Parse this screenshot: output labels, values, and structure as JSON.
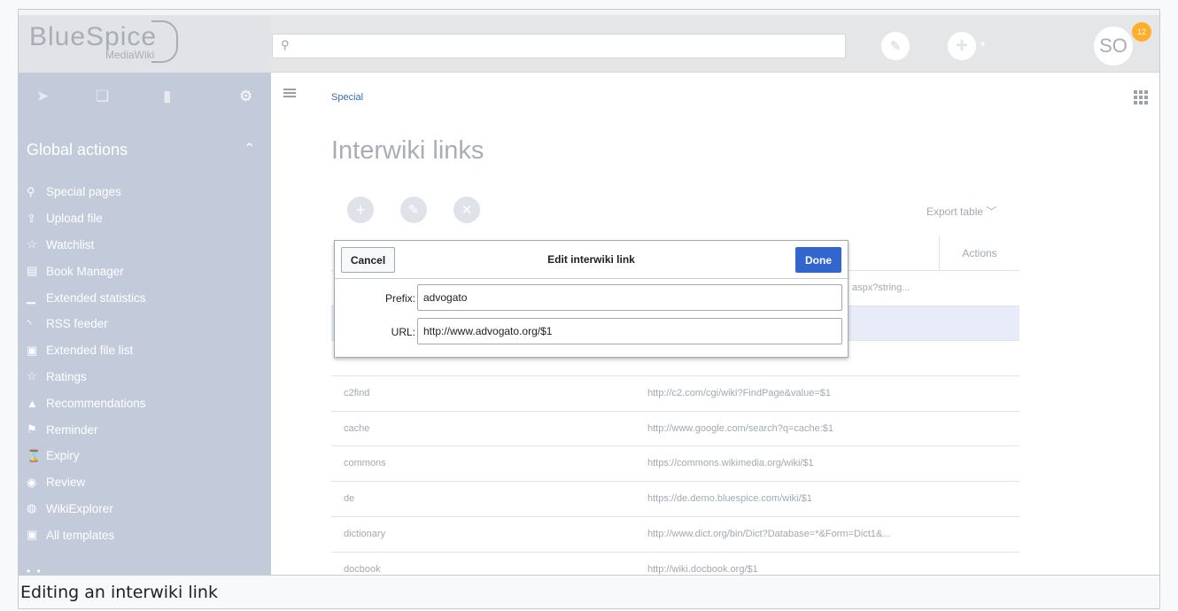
{
  "logo": {
    "main": "BlueSpice",
    "sub": "MediaWiki"
  },
  "search": {
    "placeholder": ""
  },
  "user": {
    "initials": "SO",
    "notification_count": "12"
  },
  "sidebar": {
    "section_title": "Global actions",
    "items": [
      {
        "icon": "special-pages-icon",
        "glyph": "⚲",
        "label": "Special pages"
      },
      {
        "icon": "upload-icon",
        "glyph": "⇪",
        "label": "Upload file"
      },
      {
        "icon": "star-icon",
        "glyph": "☆",
        "label": "Watchlist"
      },
      {
        "icon": "book-icon",
        "glyph": "▤",
        "label": "Book Manager"
      },
      {
        "icon": "chart-icon",
        "glyph": "▁",
        "label": "Extended statistics"
      },
      {
        "icon": "rss-icon",
        "glyph": "◝",
        "label": "RSS feeder"
      },
      {
        "icon": "file-list-icon",
        "glyph": "▣",
        "label": "Extended file list"
      },
      {
        "icon": "star-icon",
        "glyph": "☆",
        "label": "Ratings"
      },
      {
        "icon": "thumb-icon",
        "glyph": "▲",
        "label": "Recommendations"
      },
      {
        "icon": "flag-icon",
        "glyph": "⚑",
        "label": "Reminder"
      },
      {
        "icon": "hourglass-icon",
        "glyph": "⌛",
        "label": "Expiry"
      },
      {
        "icon": "eye-icon",
        "glyph": "◉",
        "label": "Review"
      },
      {
        "icon": "globe-icon",
        "glyph": "◍",
        "label": "WikiExplorer"
      },
      {
        "icon": "template-icon",
        "glyph": "▣",
        "label": "All templates"
      }
    ]
  },
  "breadcrumb": "Special",
  "page_title": "Interwiki links",
  "export_label": "Export table",
  "table": {
    "actions_header": "Actions",
    "rows": [
      {
        "prefix": "",
        "url": "aspx?string..."
      },
      {
        "prefix": "",
        "url": ""
      },
      {
        "prefix": "",
        "url": ""
      },
      {
        "prefix": "c2find",
        "url": "http://c2.com/cgi/wiki?FindPage&value=$1"
      },
      {
        "prefix": "cache",
        "url": "http://www.google.com/search?q=cache:$1"
      },
      {
        "prefix": "commons",
        "url": "https://commons.wikimedia.org/wiki/$1"
      },
      {
        "prefix": "de",
        "url": "https://de.demo.bluespice.com/wiki/$1"
      },
      {
        "prefix": "dictionary",
        "url": "http://www.dict.org/bin/Dict?Database=*&Form=Dict1&..."
      },
      {
        "prefix": "docbook",
        "url": "http://wiki.docbook.org/$1"
      }
    ]
  },
  "dialog": {
    "title": "Edit interwiki link",
    "cancel_label": "Cancel",
    "done_label": "Done",
    "prefix_label": "Prefix:",
    "prefix_value": "advogato",
    "url_label": "URL:",
    "url_value": "http://www.advogato.org/$1"
  },
  "caption": "Editing an interwiki link",
  "colors": {
    "sidebar": "#c3cad9",
    "accent": "#3366cc",
    "badge": "#ffae2a"
  }
}
